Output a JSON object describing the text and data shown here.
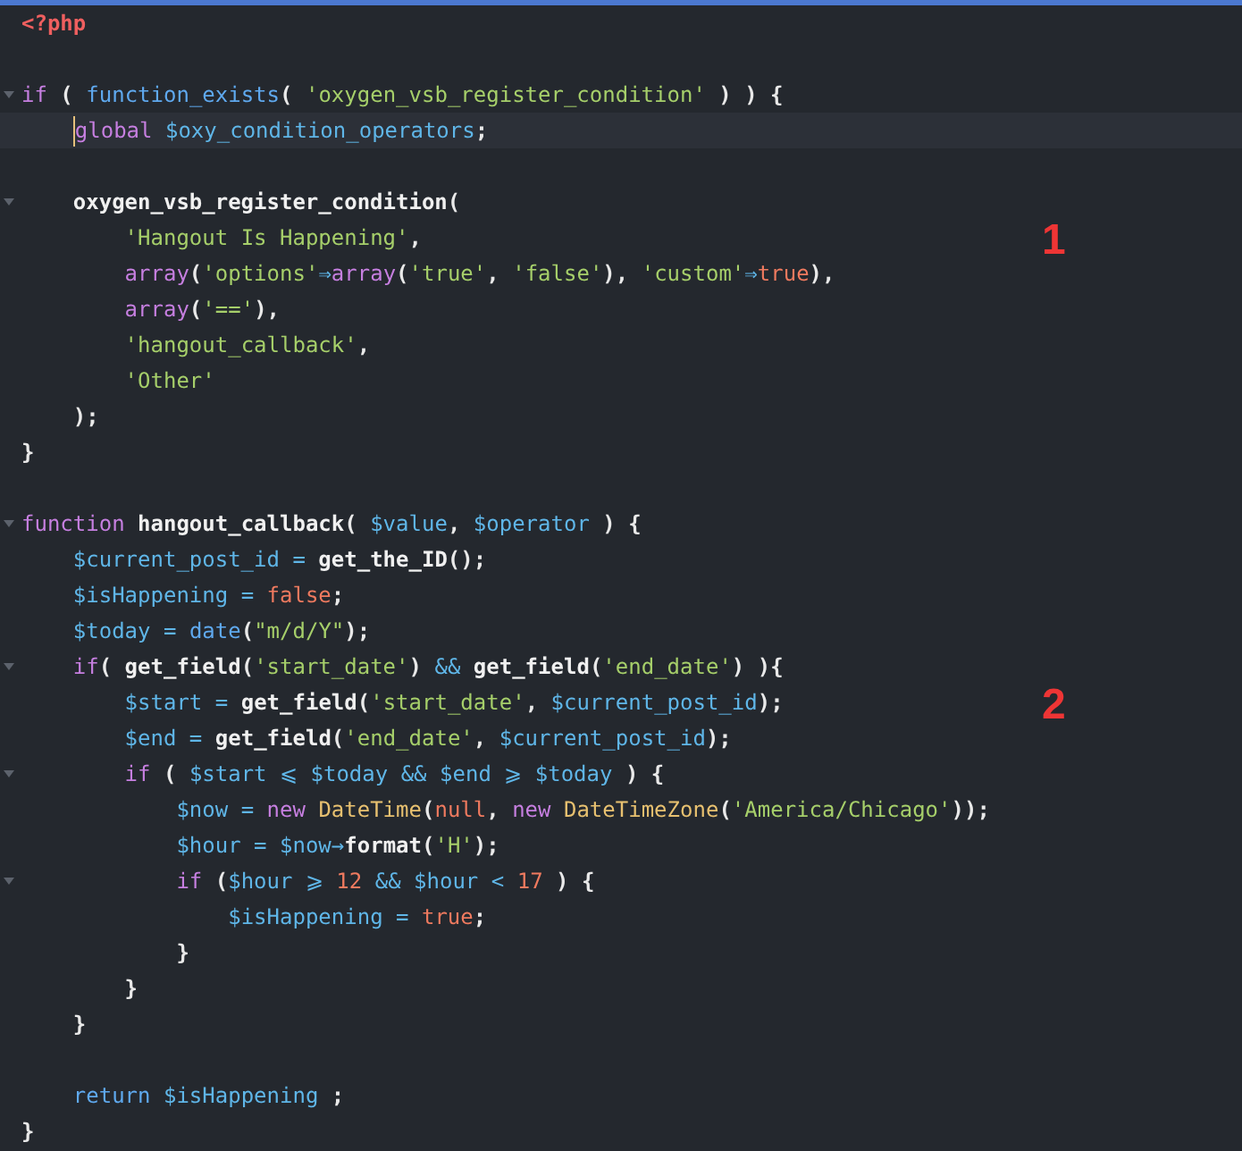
{
  "editor": {
    "lines": [
      {
        "foldable": false,
        "active": false,
        "tokens": [
          {
            "kind": "tag",
            "t": "<?php"
          }
        ]
      },
      {
        "foldable": false,
        "active": false
      },
      {
        "foldable": true,
        "active": false,
        "tokens": [
          {
            "kind": "kw",
            "t": "if"
          },
          {
            "kind": "p",
            "t": " ( "
          },
          {
            "kind": "fn",
            "t": "function_exists"
          },
          {
            "kind": "p",
            "t": "( "
          },
          {
            "kind": "str",
            "t": "'oxygen_vsb_register_condition'"
          },
          {
            "kind": "p",
            "t": " ) ) {"
          }
        ]
      },
      {
        "foldable": false,
        "active": true,
        "tokens": [
          {
            "kind": "kw",
            "t": "    global "
          },
          {
            "kind": "var",
            "t": "$oxy_condition_operators"
          },
          {
            "kind": "p",
            "t": ";"
          }
        ]
      },
      {
        "foldable": false,
        "active": false
      },
      {
        "foldable": true,
        "active": false,
        "tokens": [
          {
            "kind": "uf",
            "t": "    oxygen_vsb_register_condition"
          },
          {
            "kind": "p",
            "t": "("
          }
        ]
      },
      {
        "foldable": false,
        "active": false,
        "note": "1",
        "tokens": [
          {
            "kind": "str",
            "t": "        'Hangout Is Happening'"
          },
          {
            "kind": "p",
            "t": ","
          }
        ]
      },
      {
        "foldable": false,
        "active": false,
        "tokens": [
          {
            "kind": "kw",
            "t": "        array"
          },
          {
            "kind": "p",
            "t": "("
          },
          {
            "kind": "str",
            "t": "'options'"
          },
          {
            "kind": "op",
            "t": "⇒"
          },
          {
            "kind": "kw",
            "t": "array"
          },
          {
            "kind": "p",
            "t": "("
          },
          {
            "kind": "str",
            "t": "'true'"
          },
          {
            "kind": "p",
            "t": ", "
          },
          {
            "kind": "str",
            "t": "'false'"
          },
          {
            "kind": "p",
            "t": "), "
          },
          {
            "kind": "str",
            "t": "'custom'"
          },
          {
            "kind": "op",
            "t": "⇒"
          },
          {
            "kind": "num",
            "t": "true"
          },
          {
            "kind": "p",
            "t": "),"
          }
        ]
      },
      {
        "foldable": false,
        "active": false,
        "tokens": [
          {
            "kind": "kw",
            "t": "        array"
          },
          {
            "kind": "p",
            "t": "("
          },
          {
            "kind": "str",
            "t": "'=='"
          },
          {
            "kind": "p",
            "t": "),"
          }
        ]
      },
      {
        "foldable": false,
        "active": false,
        "tokens": [
          {
            "kind": "str",
            "t": "        'hangout_callback'"
          },
          {
            "kind": "p",
            "t": ","
          }
        ]
      },
      {
        "foldable": false,
        "active": false,
        "tokens": [
          {
            "kind": "str",
            "t": "        'Other'"
          }
        ]
      },
      {
        "foldable": false,
        "active": false,
        "tokens": [
          {
            "kind": "p",
            "t": "    );"
          }
        ]
      },
      {
        "foldable": false,
        "active": false,
        "tokens": [
          {
            "kind": "p",
            "t": "}"
          }
        ]
      },
      {
        "foldable": false,
        "active": false
      },
      {
        "foldable": true,
        "active": false,
        "tokens": [
          {
            "kind": "kw",
            "t": "function "
          },
          {
            "kind": "uf",
            "t": "hangout_callback"
          },
          {
            "kind": "p",
            "t": "( "
          },
          {
            "kind": "var",
            "t": "$value"
          },
          {
            "kind": "p",
            "t": ", "
          },
          {
            "kind": "var",
            "t": "$operator"
          },
          {
            "kind": "p",
            "t": " ) {"
          }
        ]
      },
      {
        "foldable": false,
        "active": false,
        "tokens": [
          {
            "kind": "var",
            "t": "    $current_post_id"
          },
          {
            "kind": "op",
            "t": " = "
          },
          {
            "kind": "uf",
            "t": "get_the_ID"
          },
          {
            "kind": "p",
            "t": "();"
          }
        ]
      },
      {
        "foldable": false,
        "active": false,
        "tokens": [
          {
            "kind": "var",
            "t": "    $isHappening"
          },
          {
            "kind": "op",
            "t": " = "
          },
          {
            "kind": "num",
            "t": "false"
          },
          {
            "kind": "p",
            "t": ";"
          }
        ]
      },
      {
        "foldable": false,
        "active": false,
        "tokens": [
          {
            "kind": "var",
            "t": "    $today"
          },
          {
            "kind": "op",
            "t": " = "
          },
          {
            "kind": "fn",
            "t": "date"
          },
          {
            "kind": "p",
            "t": "("
          },
          {
            "kind": "str",
            "t": "\"m/d/Y\""
          },
          {
            "kind": "p",
            "t": ");"
          }
        ]
      },
      {
        "foldable": true,
        "active": false,
        "tokens": [
          {
            "kind": "kw",
            "t": "    if"
          },
          {
            "kind": "p",
            "t": "( "
          },
          {
            "kind": "uf",
            "t": "get_field"
          },
          {
            "kind": "p",
            "t": "("
          },
          {
            "kind": "str",
            "t": "'start_date'"
          },
          {
            "kind": "p",
            "t": ") "
          },
          {
            "kind": "op",
            "t": "&& "
          },
          {
            "kind": "uf",
            "t": "get_field"
          },
          {
            "kind": "p",
            "t": "("
          },
          {
            "kind": "str",
            "t": "'end_date'"
          },
          {
            "kind": "p",
            "t": ") ){"
          }
        ]
      },
      {
        "foldable": false,
        "active": false,
        "note": "2",
        "tokens": [
          {
            "kind": "var",
            "t": "        $start"
          },
          {
            "kind": "op",
            "t": " = "
          },
          {
            "kind": "uf",
            "t": "get_field"
          },
          {
            "kind": "p",
            "t": "("
          },
          {
            "kind": "str",
            "t": "'start_date'"
          },
          {
            "kind": "p",
            "t": ", "
          },
          {
            "kind": "var",
            "t": "$current_post_id"
          },
          {
            "kind": "p",
            "t": ");"
          }
        ]
      },
      {
        "foldable": false,
        "active": false,
        "tokens": [
          {
            "kind": "var",
            "t": "        $end"
          },
          {
            "kind": "op",
            "t": " = "
          },
          {
            "kind": "uf",
            "t": "get_field"
          },
          {
            "kind": "p",
            "t": "("
          },
          {
            "kind": "str",
            "t": "'end_date'"
          },
          {
            "kind": "p",
            "t": ", "
          },
          {
            "kind": "var",
            "t": "$current_post_id"
          },
          {
            "kind": "p",
            "t": ");"
          }
        ]
      },
      {
        "foldable": true,
        "active": false,
        "tokens": [
          {
            "kind": "kw",
            "t": "        if"
          },
          {
            "kind": "p",
            "t": " ( "
          },
          {
            "kind": "var",
            "t": "$start"
          },
          {
            "kind": "op",
            "t": " ⩽ "
          },
          {
            "kind": "var",
            "t": "$today"
          },
          {
            "kind": "op",
            "t": " && "
          },
          {
            "kind": "var",
            "t": "$end"
          },
          {
            "kind": "op",
            "t": " ⩾ "
          },
          {
            "kind": "var",
            "t": "$today"
          },
          {
            "kind": "p",
            "t": " ) {"
          }
        ]
      },
      {
        "foldable": false,
        "active": false,
        "tokens": [
          {
            "kind": "var",
            "t": "            $now"
          },
          {
            "kind": "op",
            "t": " = "
          },
          {
            "kind": "kw",
            "t": "new "
          },
          {
            "kind": "cls",
            "t": "DateTime"
          },
          {
            "kind": "p",
            "t": "("
          },
          {
            "kind": "num",
            "t": "null"
          },
          {
            "kind": "p",
            "t": ", "
          },
          {
            "kind": "kw",
            "t": "new "
          },
          {
            "kind": "cls",
            "t": "DateTimeZone"
          },
          {
            "kind": "p",
            "t": "("
          },
          {
            "kind": "str",
            "t": "'America/Chicago'"
          },
          {
            "kind": "p",
            "t": "));"
          }
        ]
      },
      {
        "foldable": false,
        "active": false,
        "tokens": [
          {
            "kind": "var",
            "t": "            $hour"
          },
          {
            "kind": "op",
            "t": " = "
          },
          {
            "kind": "var",
            "t": "$now"
          },
          {
            "kind": "op",
            "t": "→"
          },
          {
            "kind": "uf",
            "t": "format"
          },
          {
            "kind": "p",
            "t": "("
          },
          {
            "kind": "str",
            "t": "'H'"
          },
          {
            "kind": "p",
            "t": ");"
          }
        ]
      },
      {
        "foldable": true,
        "active": false,
        "tokens": [
          {
            "kind": "kw",
            "t": "            if"
          },
          {
            "kind": "p",
            "t": " ("
          },
          {
            "kind": "var",
            "t": "$hour"
          },
          {
            "kind": "op",
            "t": " ⩾ "
          },
          {
            "kind": "num",
            "t": "12"
          },
          {
            "kind": "op",
            "t": " && "
          },
          {
            "kind": "var",
            "t": "$hour"
          },
          {
            "kind": "op",
            "t": " < "
          },
          {
            "kind": "num",
            "t": "17"
          },
          {
            "kind": "p",
            "t": " ) {"
          }
        ]
      },
      {
        "foldable": false,
        "active": false,
        "tokens": [
          {
            "kind": "var",
            "t": "                $isHappening"
          },
          {
            "kind": "op",
            "t": " = "
          },
          {
            "kind": "num",
            "t": "true"
          },
          {
            "kind": "p",
            "t": ";"
          }
        ]
      },
      {
        "foldable": false,
        "active": false,
        "tokens": [
          {
            "kind": "p",
            "t": "            }"
          }
        ]
      },
      {
        "foldable": false,
        "active": false,
        "tokens": [
          {
            "kind": "p",
            "t": "        }"
          }
        ]
      },
      {
        "foldable": false,
        "active": false,
        "tokens": [
          {
            "kind": "p",
            "t": "    }"
          }
        ]
      },
      {
        "foldable": false,
        "active": false
      },
      {
        "foldable": false,
        "active": false,
        "tokens": [
          {
            "kind": "fn",
            "t": "    return "
          },
          {
            "kind": "var",
            "t": "$isHappening"
          },
          {
            "kind": "p",
            "t": " ;"
          }
        ]
      },
      {
        "foldable": false,
        "active": false,
        "tokens": [
          {
            "kind": "p",
            "t": "}"
          }
        ]
      }
    ]
  }
}
